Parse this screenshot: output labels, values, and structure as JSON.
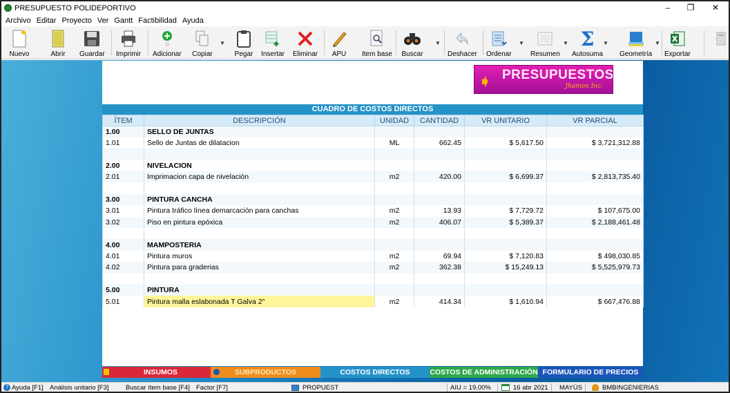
{
  "window": {
    "title": "PRESUPUESTO POLIDEPORTIVO",
    "min": "–",
    "max": "❐",
    "close": "✕"
  },
  "menu": [
    "Archivo",
    "Editar",
    "Proyecto",
    "Ver",
    "Gantt",
    "Factibilidad",
    "Ayuda"
  ],
  "toolbar": {
    "nuevo": "Nuevo",
    "abrir": "Abrir",
    "guardar": "Guardar",
    "imprimir": "Imprimir",
    "adicionar": "Adicionar",
    "copiar": "Copiar",
    "pegar": "Pegar",
    "insertar": "Insertar",
    "eliminar": "Eliminar",
    "apu": "APU",
    "item_base": "Item base",
    "buscar": "Buscar",
    "deshacer": "Deshacer",
    "ordenar": "Ordenar",
    "resumen": "Resumen",
    "autosuma": "Autosuma",
    "geometria": "Geometría",
    "exportar": "Exportar"
  },
  "logo": {
    "brand": "PRESUPUESTOS",
    "sub": "Jhamon Inc."
  },
  "table": {
    "caption": "CUADRO DE COSTOS DIRECTOS",
    "headers": {
      "item": "ÍTEM",
      "descripcion": "DESCRIPCIÓN",
      "unidad": "UNIDAD",
      "cantidad": "CANTIDAD",
      "vr_unitario": "VR UNITARIO",
      "vr_parcial": "VR PARCIAL"
    },
    "rows": [
      {
        "item": "1.00",
        "desc": "SELLO DE JUNTAS",
        "unit": "",
        "qty": "",
        "vu": "",
        "vp": "",
        "chapter": true
      },
      {
        "item": "1.01",
        "desc": "Sello de Juntas de dilatacion",
        "unit": "ML",
        "qty": "662.45",
        "vu": "$ 5,617.50",
        "vp": "$ 3,721,312.88"
      },
      {
        "item": "",
        "desc": "",
        "unit": "",
        "qty": "",
        "vu": "",
        "vp": ""
      },
      {
        "item": "2.00",
        "desc": "NIVELACION",
        "unit": "",
        "qty": "",
        "vu": "",
        "vp": "",
        "chapter": true
      },
      {
        "item": "2.01",
        "desc": "Imprimacion capa de nivelación",
        "unit": "m2",
        "qty": "420.00",
        "vu": "$ 6,699.37",
        "vp": "$ 2,813,735.40"
      },
      {
        "item": "",
        "desc": "",
        "unit": "",
        "qty": "",
        "vu": "",
        "vp": ""
      },
      {
        "item": "3.00",
        "desc": "PINTURA CANCHA",
        "unit": "",
        "qty": "",
        "vu": "",
        "vp": "",
        "chapter": true
      },
      {
        "item": "3.01",
        "desc": "Pintura tráfico línea demarcación para canchas",
        "unit": "m2",
        "qty": "13.93",
        "vu": "$ 7,729.72",
        "vp": "$ 107,675.00"
      },
      {
        "item": "3.02",
        "desc": "Piso en pintura epóxica",
        "unit": "m2",
        "qty": "406.07",
        "vu": "$ 5,389.37",
        "vp": "$ 2,188,461.48"
      },
      {
        "item": "",
        "desc": "",
        "unit": "",
        "qty": "",
        "vu": "",
        "vp": ""
      },
      {
        "item": "4.00",
        "desc": "MAMPOSTERIA",
        "unit": "",
        "qty": "",
        "vu": "",
        "vp": "",
        "chapter": true
      },
      {
        "item": "4.01",
        "desc": "Pintura muros",
        "unit": "m2",
        "qty": "69.94",
        "vu": "$ 7,120.83",
        "vp": "$ 498,030.85"
      },
      {
        "item": "4.02",
        "desc": "Pintura para graderias",
        "unit": "m2",
        "qty": "362.38",
        "vu": "$ 15,249.13",
        "vp": "$ 5,525,979.73"
      },
      {
        "item": "",
        "desc": "",
        "unit": "",
        "qty": "",
        "vu": "",
        "vp": ""
      },
      {
        "item": "5.00",
        "desc": "PINTURA",
        "unit": "",
        "qty": "",
        "vu": "",
        "vp": "",
        "chapter": true
      },
      {
        "item": "5.01",
        "desc": "Pintura malla eslabonada T Galva 2\"",
        "unit": "m2",
        "qty": "414.34",
        "vu": "$ 1,610.94",
        "vp": "$ 667,476.88",
        "selected": true
      }
    ]
  },
  "tabs": [
    {
      "label": "INSUMOS",
      "color": "#d9283a"
    },
    {
      "label": "SUBPRODUCTOS",
      "color": "#f08c1e"
    },
    {
      "label": "COSTOS DIRECTOS",
      "color": "#2592c8"
    },
    {
      "label": "COSTOS DE ADMINISTRACIÓN",
      "color": "#2ea84a"
    },
    {
      "label": "FORMULARIO DE PRECIOS",
      "color": "#1a56b8"
    }
  ],
  "status": {
    "ayuda": "Ayuda [F1]",
    "analisis": "Análisis unitario [F3]",
    "buscar": "Buscar ítem base [F4]",
    "factor": "Factor [F7]",
    "file": "PROPUEST",
    "aiu": "AIU = 19.00%",
    "date": "16 abr 2021",
    "caps": "MAYÚS",
    "user": "BMBINGENIERIAS"
  },
  "colors": {
    "accent": "#2592c8",
    "header_bg": "#d6eaf7",
    "selected_row": "#fff59a",
    "logo": "#d41aa8"
  }
}
